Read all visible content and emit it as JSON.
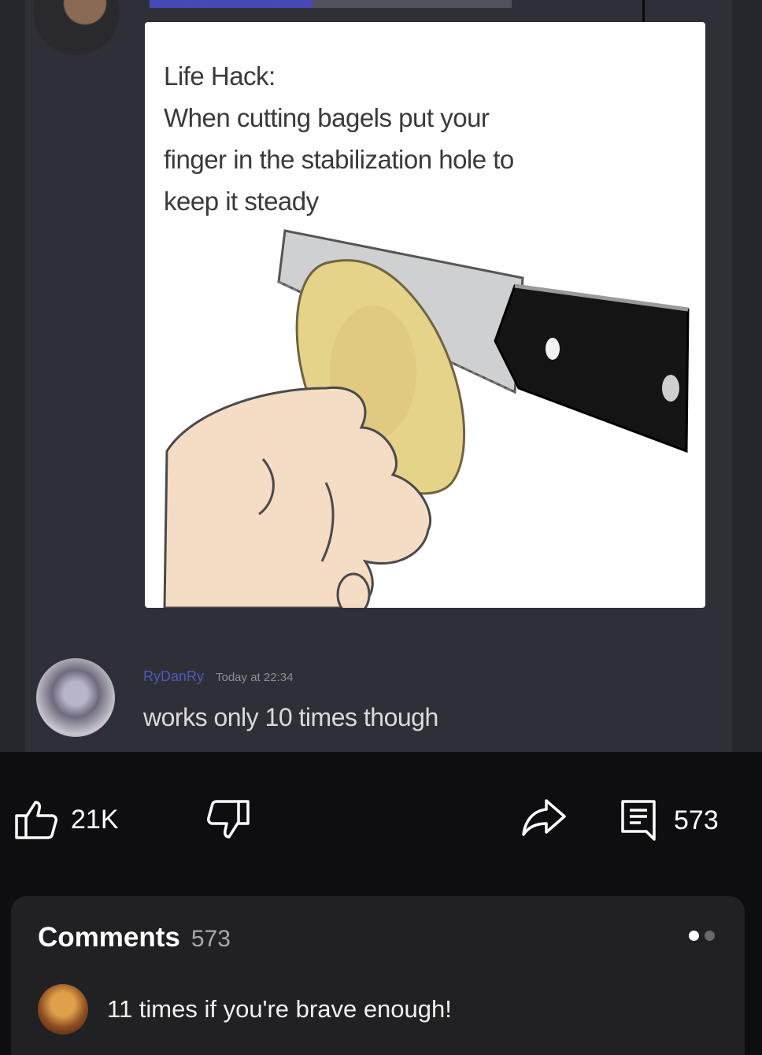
{
  "post": {
    "meme_text_lines": [
      "Life Hack:",
      "When cutting bagels put your",
      "finger in the stabilization hole to",
      "keep it steady"
    ],
    "reply": {
      "username": "RyDanRy",
      "timestamp": "Today at 22:34",
      "text": "works only 10 times though"
    }
  },
  "actions": {
    "likes": "21K",
    "comments": "573",
    "icons": {
      "like": "thumbs-up-icon",
      "dislike": "thumbs-down-icon",
      "share": "share-arrow-icon",
      "comments": "comments-icon"
    }
  },
  "comments": {
    "title": "Comments",
    "count": "573",
    "top_comment": {
      "text": "11 times if you're brave enough!"
    }
  },
  "colors": {
    "background": "#0e0e10",
    "panel": "#212124",
    "discord_bg": "#2f3037",
    "username": "#5865f2"
  }
}
